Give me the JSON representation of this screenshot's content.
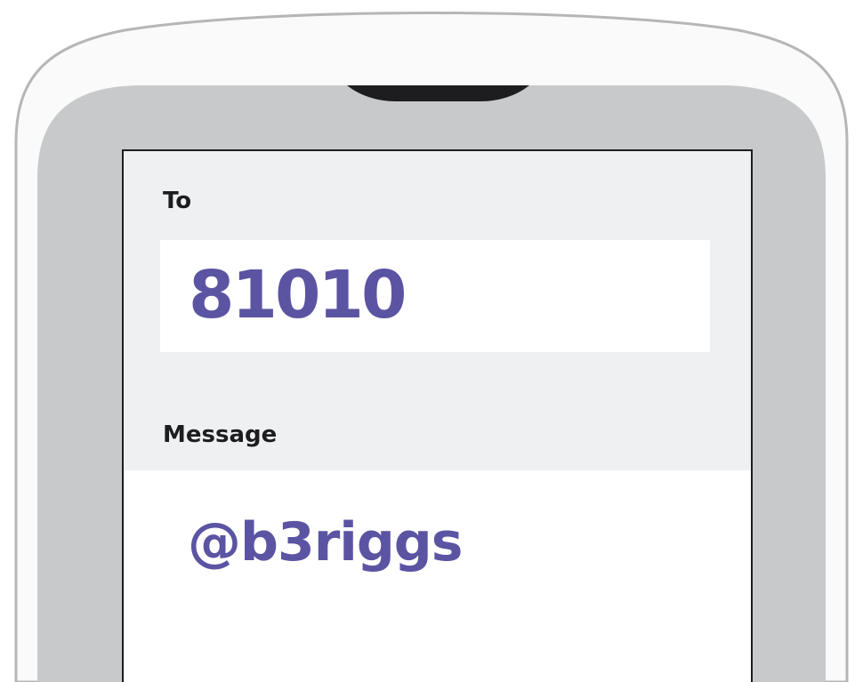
{
  "form": {
    "to_label": "To",
    "to_value": "81010",
    "message_label": "Message",
    "message_value": "@b3riggs"
  },
  "colors": {
    "accent": "#5b54a2",
    "label": "#1d1d1f",
    "bezel": "#c8c9cb",
    "screen": "#eef0f1",
    "field": "#ffffff"
  },
  "icons": {
    "speaker": "phone-speaker-icon"
  }
}
